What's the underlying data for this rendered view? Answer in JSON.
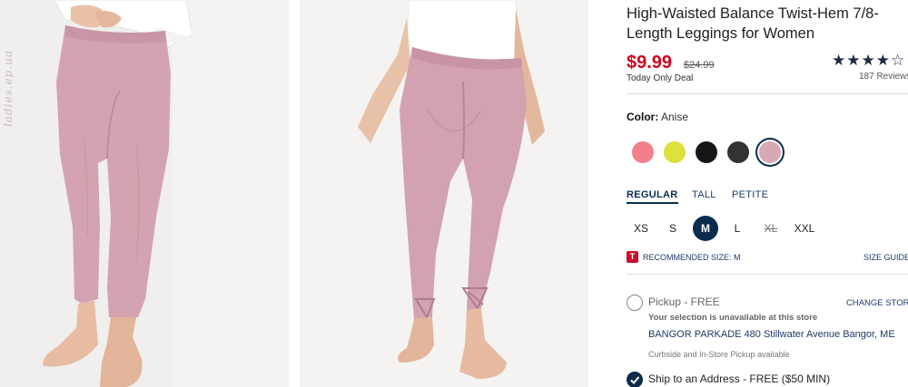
{
  "gallery": {
    "watermark": "ladies.ep.ua",
    "images": [
      {
        "name": "front view photo",
        "pants_color": "#d4a3b2"
      },
      {
        "name": "back view photo",
        "pants_color": "#d2a2b1"
      }
    ]
  },
  "product": {
    "title": "High-Waisted Balance Twist-Hem 7/8-Length Leggings for Women",
    "price": "$9.99",
    "original_price": "$24.99",
    "deal_label": "Today Only Deal",
    "rating_stars": "★★★★☆",
    "rating_value": 4.5,
    "reviews_label": "187 Reviews"
  },
  "color": {
    "label": "Color:",
    "selected_name": "Anise",
    "swatches": [
      {
        "name": "coral",
        "hex": "#f27f89"
      },
      {
        "name": "lime",
        "hex": "#d9e13a"
      },
      {
        "name": "black",
        "hex": "#161616"
      },
      {
        "name": "charcoal",
        "hex": "#333335"
      },
      {
        "name": "anise",
        "hex": "#d7a9b5",
        "selected": true
      }
    ]
  },
  "fit": {
    "tabs": [
      "REGULAR",
      "TALL",
      "PETITE"
    ],
    "active": "REGULAR"
  },
  "sizes": {
    "options": [
      "XS",
      "S",
      "M",
      "L",
      "XL",
      "XXL"
    ],
    "selected": "M",
    "unavailable": [
      "XL"
    ]
  },
  "recommendation": {
    "badge": "T",
    "text": "RECOMMENDED SIZE: M",
    "size_guide": "SIZE GUIDE"
  },
  "fulfillment": {
    "pickup_label": "Pickup - FREE",
    "change_store": "CHANGE STORE",
    "unavailable_msg": "Your selection is unavailable at this store",
    "store_address": "BANGOR PARKADE 480 Stillwater Avenue  Bangor, ME",
    "store_note": "Curbside and In-Store Pickup available",
    "ship_label": "Ship to an Address - FREE ($50 MIN)"
  },
  "colors": {
    "accent": "#0c2c4f",
    "sale_red": "#d0021b",
    "link_blue": "#1f3a66"
  }
}
